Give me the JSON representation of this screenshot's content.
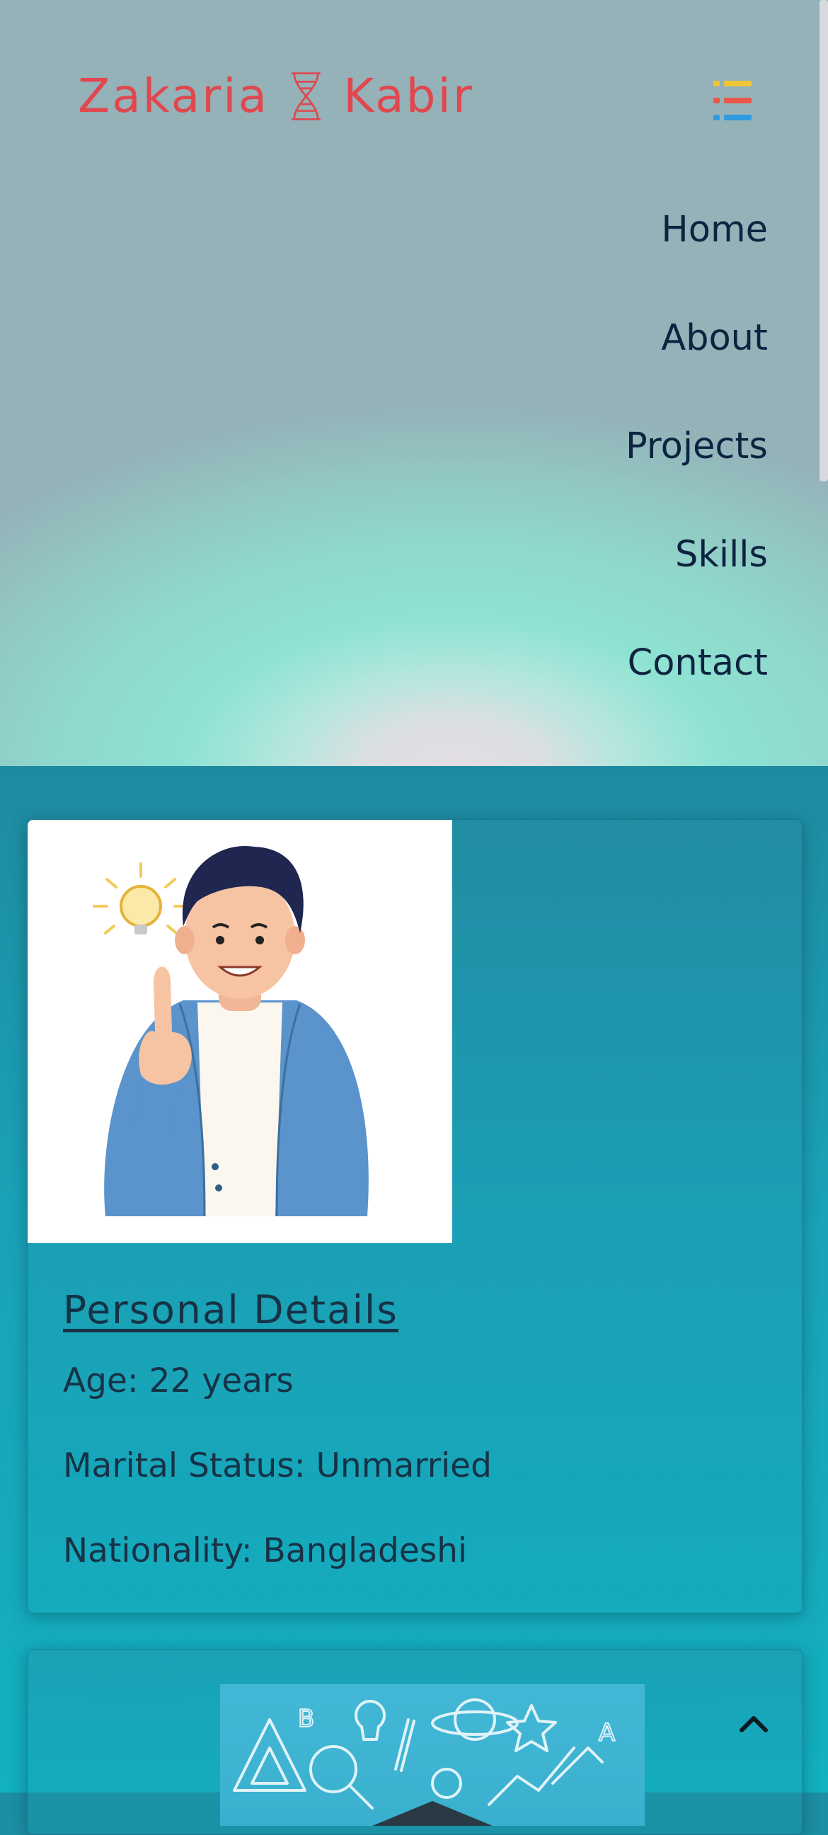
{
  "header": {
    "logo_left": "Zakaria",
    "logo_right": "Kabir",
    "logo_mark_icon": "dna-icon",
    "menu_icon": "list-menu-icon"
  },
  "nav": {
    "items": [
      "Home",
      "About",
      "Projects",
      "Skills",
      "Contact"
    ]
  },
  "personal_details": {
    "image_icon": "person-idea-illustration",
    "title": "Personal Details",
    "age": "Age: 22 years",
    "marital_status": "Marital Status: Unmarried",
    "nationality": "Nationality: Bangladeshi"
  },
  "education_card": {
    "image_icon": "education-doodle-illustration"
  },
  "back_to_top_icon": "chevron-up-icon",
  "colors": {
    "logo": "#e0474f",
    "nav_text": "#0d2340",
    "card_text": "#163246",
    "content_bg": "#1aa3b8"
  }
}
